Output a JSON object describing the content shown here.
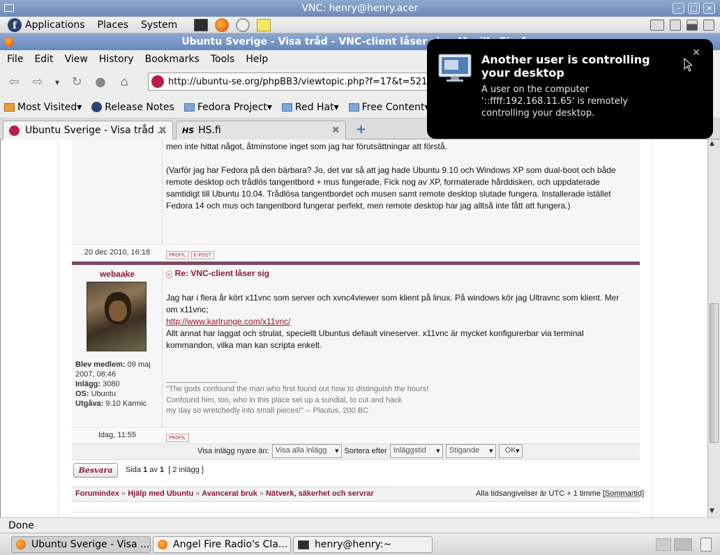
{
  "vnc_window": {
    "title": "VNC: henry@henry.acer"
  },
  "gnome_panel": {
    "menus": [
      "Applications",
      "Places",
      "System"
    ]
  },
  "firefox": {
    "window_title": "Ubuntu Sverige - Visa tråd - VNC-client låser sig - Mozilla Firefox",
    "menus": [
      "File",
      "Edit",
      "View",
      "History",
      "Bookmarks",
      "Tools",
      "Help"
    ],
    "url": "http://ubuntu-se.org/phpBB3/viewtopic.php?f=17&t=521",
    "bookmarks": [
      "Most Visited",
      "Release Notes",
      "Fedora Project",
      "Red Hat",
      "Free Content"
    ],
    "tabs": [
      {
        "label": "Ubuntu Sverige - Visa tråd ...",
        "active": true
      },
      {
        "label": "HS.fi",
        "active": false
      }
    ],
    "status": "Done"
  },
  "page": {
    "post1": {
      "line_top": "men inte hittat något, åtminstone inget som jag har förutsättningar att förstå.",
      "para": [
        "(Varför jag har Fedora på den bärbara? Jo, det var så att jag hade Ubuntu 9.10 och Windows XP som dual-boot och både",
        "remote desktop och trådlös tangentbord + mus fungerade. Fick nog av XP, formaterade hårddisken, och uppdaterade",
        "samtidigt till Ubuntu 10.04. Trådlösa tangentbordet och musen samt remote desktop slutade fungera. Installerade istället",
        "Fedora 14 och mus och tangentbord fungerar perfekt, men remote desktop har jag alltså inte fått att fungera.)"
      ],
      "date": "20 dec 2010, 16:18",
      "buttons": [
        "PROFIL",
        "E-POST"
      ]
    },
    "post2": {
      "author": "webaake",
      "subject": "Re: VNC-client låser sig",
      "lines": [
        "Jag har i flera år kört x11vnc som server och xvnc4viewer som klient på linux. På windows kör jag Ultravnc som klient. Mer",
        "om x11vnc;"
      ],
      "link": "http://www.karlrunge.com/x11vnc/",
      "lines2": [
        "Allt annat har laggat och strulat, speciellt Ubuntus default vineserver. x11vnc är mycket konfigurerbar via terminal",
        "kommandon, vilka man kan scripta enkelt."
      ],
      "signature": [
        "\"The gods confound the man who first found out how to distinguish the hours!",
        "Confound him, too, who in this place set up a sundial, to cut and hack",
        "my day so wretchedly into small pieces!\" -- Plautus, 200 BC"
      ],
      "member_since_label": "Blev medlem:",
      "member_since_value": "09 maj",
      "member_since_value2": "2007, 08:46",
      "posts_label": "Inlägg:",
      "posts_value": "3080",
      "os_label": "OS:",
      "os_value": "Ubuntu",
      "edition_label": "Utgåva:",
      "edition_value": "9.10 Karmic",
      "date": "Idag, 11:55",
      "buttons": [
        "PROFIL"
      ]
    },
    "filter": {
      "show_label": "Visa inlägg nyare än:",
      "show_value": "Visa alla inlägg",
      "sort_label": "Sortera efter",
      "sort_value": "Inläggstid",
      "order_value": "Stigande",
      "ok": "OK"
    },
    "pagination": {
      "reply": "Besvara",
      "page_prefix": "Sida",
      "page_current": "1",
      "page_of": "av",
      "page_total": "1",
      "post_count": "[ 2 inlägg ]"
    },
    "breadcrumb": [
      "Forumindex",
      "Hjälp med Ubuntu",
      "Avancerat bruk",
      "Nätverk, säkerhet och servrar"
    ],
    "timezone_prefix": "Alla tidsangivelser är UTC + 1 timme [",
    "timezone_link": "Sommartid",
    "timezone_suffix": "]"
  },
  "notification": {
    "title_line1": "Another user is controlling",
    "title_line2": "your desktop",
    "body_line1": "A user on the computer",
    "body_line2": "'::ffff:192.168.11.65' is remotely",
    "body_line3": "controlling your desktop."
  },
  "taskbar": {
    "tasks": [
      "Ubuntu Sverige - Visa ...",
      "Angel Fire Radio's Cla...",
      "henry@henry:~"
    ]
  },
  "colors": {
    "accent": "#8a1a3a",
    "post_divider": "#7a4a64",
    "link": "#a0102d"
  }
}
